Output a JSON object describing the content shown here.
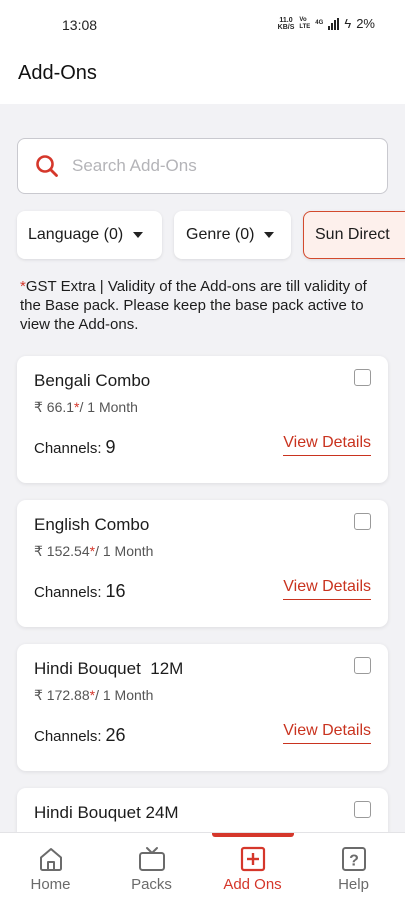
{
  "status_bar": {
    "time": "13:08",
    "net_speed_value": "11.0",
    "net_speed_unit": "KB/S",
    "volte_top": "Vo",
    "volte_bottom": "LTE",
    "network_type": "4G",
    "battery": "2%"
  },
  "header": {
    "title": "Add-Ons"
  },
  "search": {
    "placeholder": "Search Add-Ons",
    "value": ""
  },
  "filters": [
    {
      "label": "Language (0)"
    },
    {
      "label": "Genre (0)"
    },
    {
      "label": "Sun Direct",
      "selected": true
    }
  ],
  "note": {
    "asterisk": "*",
    "text": "GST Extra |  Validity of the Add-ons are till validity of the Base pack. Please keep the base pack active to view the Add-ons."
  },
  "addons": [
    {
      "name": "Bengali Combo",
      "price": "₹ 66.1",
      "price_star": "*",
      "duration": "/ 1 Month",
      "channels_label": "Channels:",
      "channels": "9",
      "details_label": "View Details",
      "checked": false
    },
    {
      "name": "English Combo",
      "price": "₹ 152.54",
      "price_star": "*",
      "duration": "/ 1 Month",
      "channels_label": "Channels:",
      "channels": "16",
      "details_label": "View Details",
      "checked": false
    },
    {
      "name": "Hindi Bouquet  12M",
      "price": "₹ 172.88",
      "price_star": "*",
      "duration": "/ 1 Month",
      "channels_label": "Channels:",
      "channels": "26",
      "details_label": "View Details",
      "checked": false
    },
    {
      "name": "Hindi Bouquet 24M",
      "checked": false
    }
  ],
  "bottom_nav": [
    {
      "label": "Home",
      "icon": "home-icon",
      "active": false
    },
    {
      "label": "Packs",
      "icon": "tv-icon",
      "active": false
    },
    {
      "label": "Add Ons",
      "icon": "add-box-icon",
      "active": true
    },
    {
      "label": "Help",
      "icon": "help-icon",
      "active": false
    }
  ],
  "colors": {
    "accent": "#d5372b",
    "background": "#f2f2f5",
    "card": "#ffffff"
  }
}
